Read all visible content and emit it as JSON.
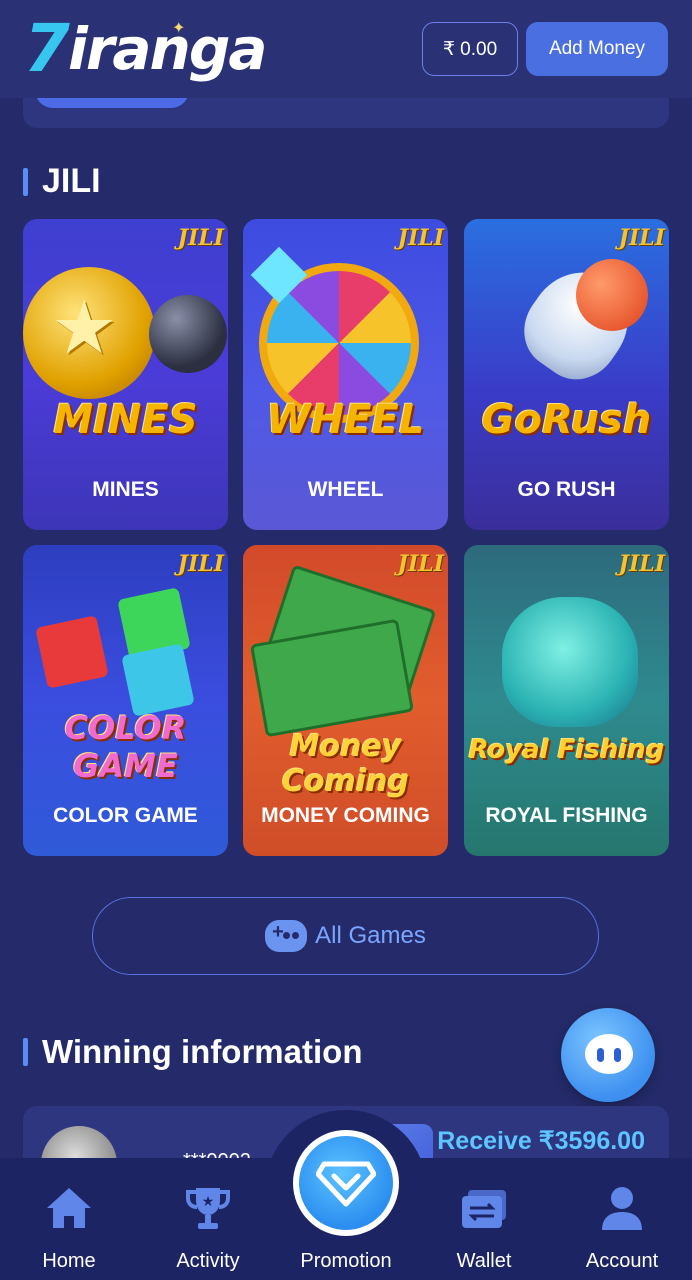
{
  "header": {
    "logo_text": "7iranga",
    "balance": "₹ 0.00",
    "add_money": "Add Money"
  },
  "jili_section": {
    "title": "JILI",
    "games": [
      {
        "name": "MINES",
        "art_title": "MINES",
        "badge": "JILI"
      },
      {
        "name": "WHEEL",
        "art_title": "WHEEL",
        "badge": "JILI"
      },
      {
        "name": "GO RUSH",
        "art_title": "GoRush",
        "badge": "JILI"
      },
      {
        "name": "COLOR GAME",
        "art_title": "COLOR GAME",
        "badge": "JILI"
      },
      {
        "name": "MONEY COMING",
        "art_title": "Money Coming",
        "badge": "JILI"
      },
      {
        "name": "ROYAL FISHING",
        "art_title": "Royal Fishing",
        "badge": "JILI"
      }
    ]
  },
  "all_games": "All Games",
  "winning": {
    "title": "Winning information",
    "entry": {
      "user": "***0002",
      "receive": "Receive ₹3596.00"
    }
  },
  "nav": {
    "home": "Home",
    "activity": "Activity",
    "promotion": "Promotion",
    "wallet": "Wallet",
    "account": "Account"
  },
  "colors": {
    "background": "#252b6a",
    "accent": "#4a6fe0",
    "nav_bg": "#1d2464",
    "receive": "#5ec6ff"
  }
}
